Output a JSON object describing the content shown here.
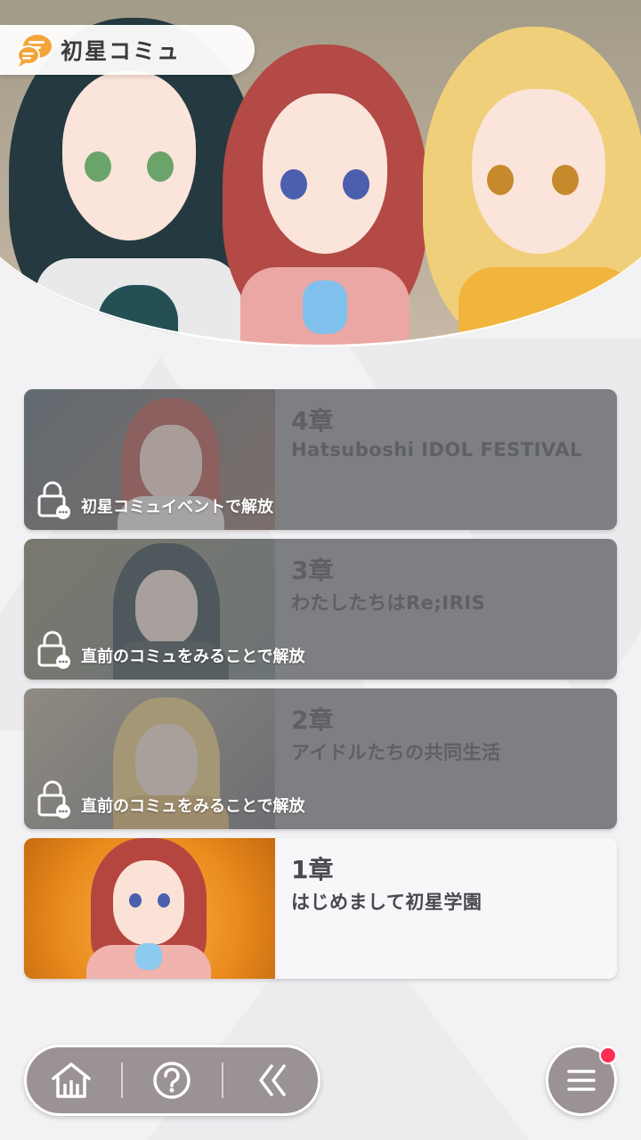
{
  "header": {
    "title": "初星コミュ",
    "icon": "chat-bubbles-icon"
  },
  "chapters": [
    {
      "number": "4章",
      "title": "Hatsuboshi IDOL FESTIVAL",
      "locked": true,
      "lock_message": "初星コミュイベントで解放"
    },
    {
      "number": "3章",
      "title": "わたしたちはRe;IRIS",
      "locked": true,
      "lock_message": "直前のコミュをみることで解放"
    },
    {
      "number": "2章",
      "title": "アイドルたちの共同生活",
      "locked": true,
      "lock_message": "直前のコミュをみることで解放"
    },
    {
      "number": "1章",
      "title": "はじめまして初星学園",
      "locked": false
    }
  ],
  "nav": {
    "home_icon": "home-icon",
    "help_icon": "help-icon",
    "back_icon": "back-chevrons-icon",
    "menu_icon": "menu-icon"
  },
  "colors": {
    "locked_panel": "#7d7f82",
    "unlocked_panel": "#f7f6f9",
    "nav_bg": "#9b9294",
    "notification": "#ff2d55"
  }
}
